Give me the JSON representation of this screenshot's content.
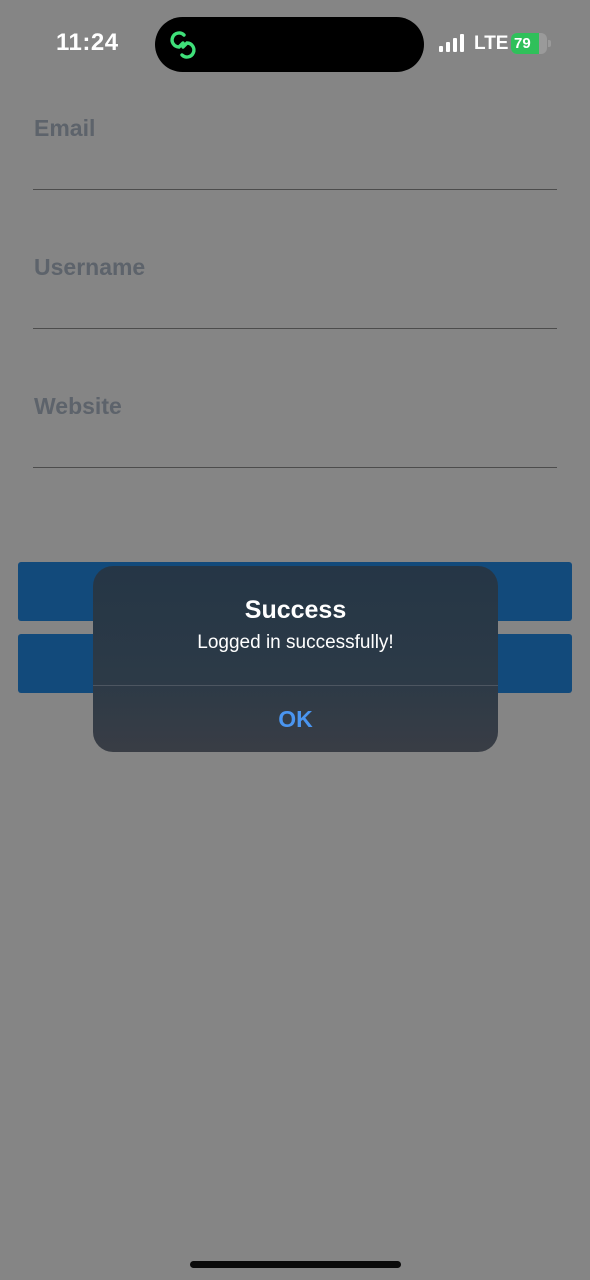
{
  "status_bar": {
    "time": "11:24",
    "network": "LTE",
    "battery_level": "79",
    "battery_fill_fraction": 0.79,
    "battery_color": "#2fc05a"
  },
  "form": {
    "fields": [
      {
        "label": "Email",
        "value": ""
      },
      {
        "label": "Username",
        "value": ""
      },
      {
        "label": "Website",
        "value": ""
      }
    ],
    "button_color": "#124a7b"
  },
  "alert": {
    "title": "Success",
    "message": "Logged in successfully!",
    "ok_label": "OK",
    "ok_color": "#4a95f0"
  },
  "icons": {
    "island": "link-icon",
    "signal": "cellular-signal-icon",
    "battery": "battery-charging-icon"
  }
}
